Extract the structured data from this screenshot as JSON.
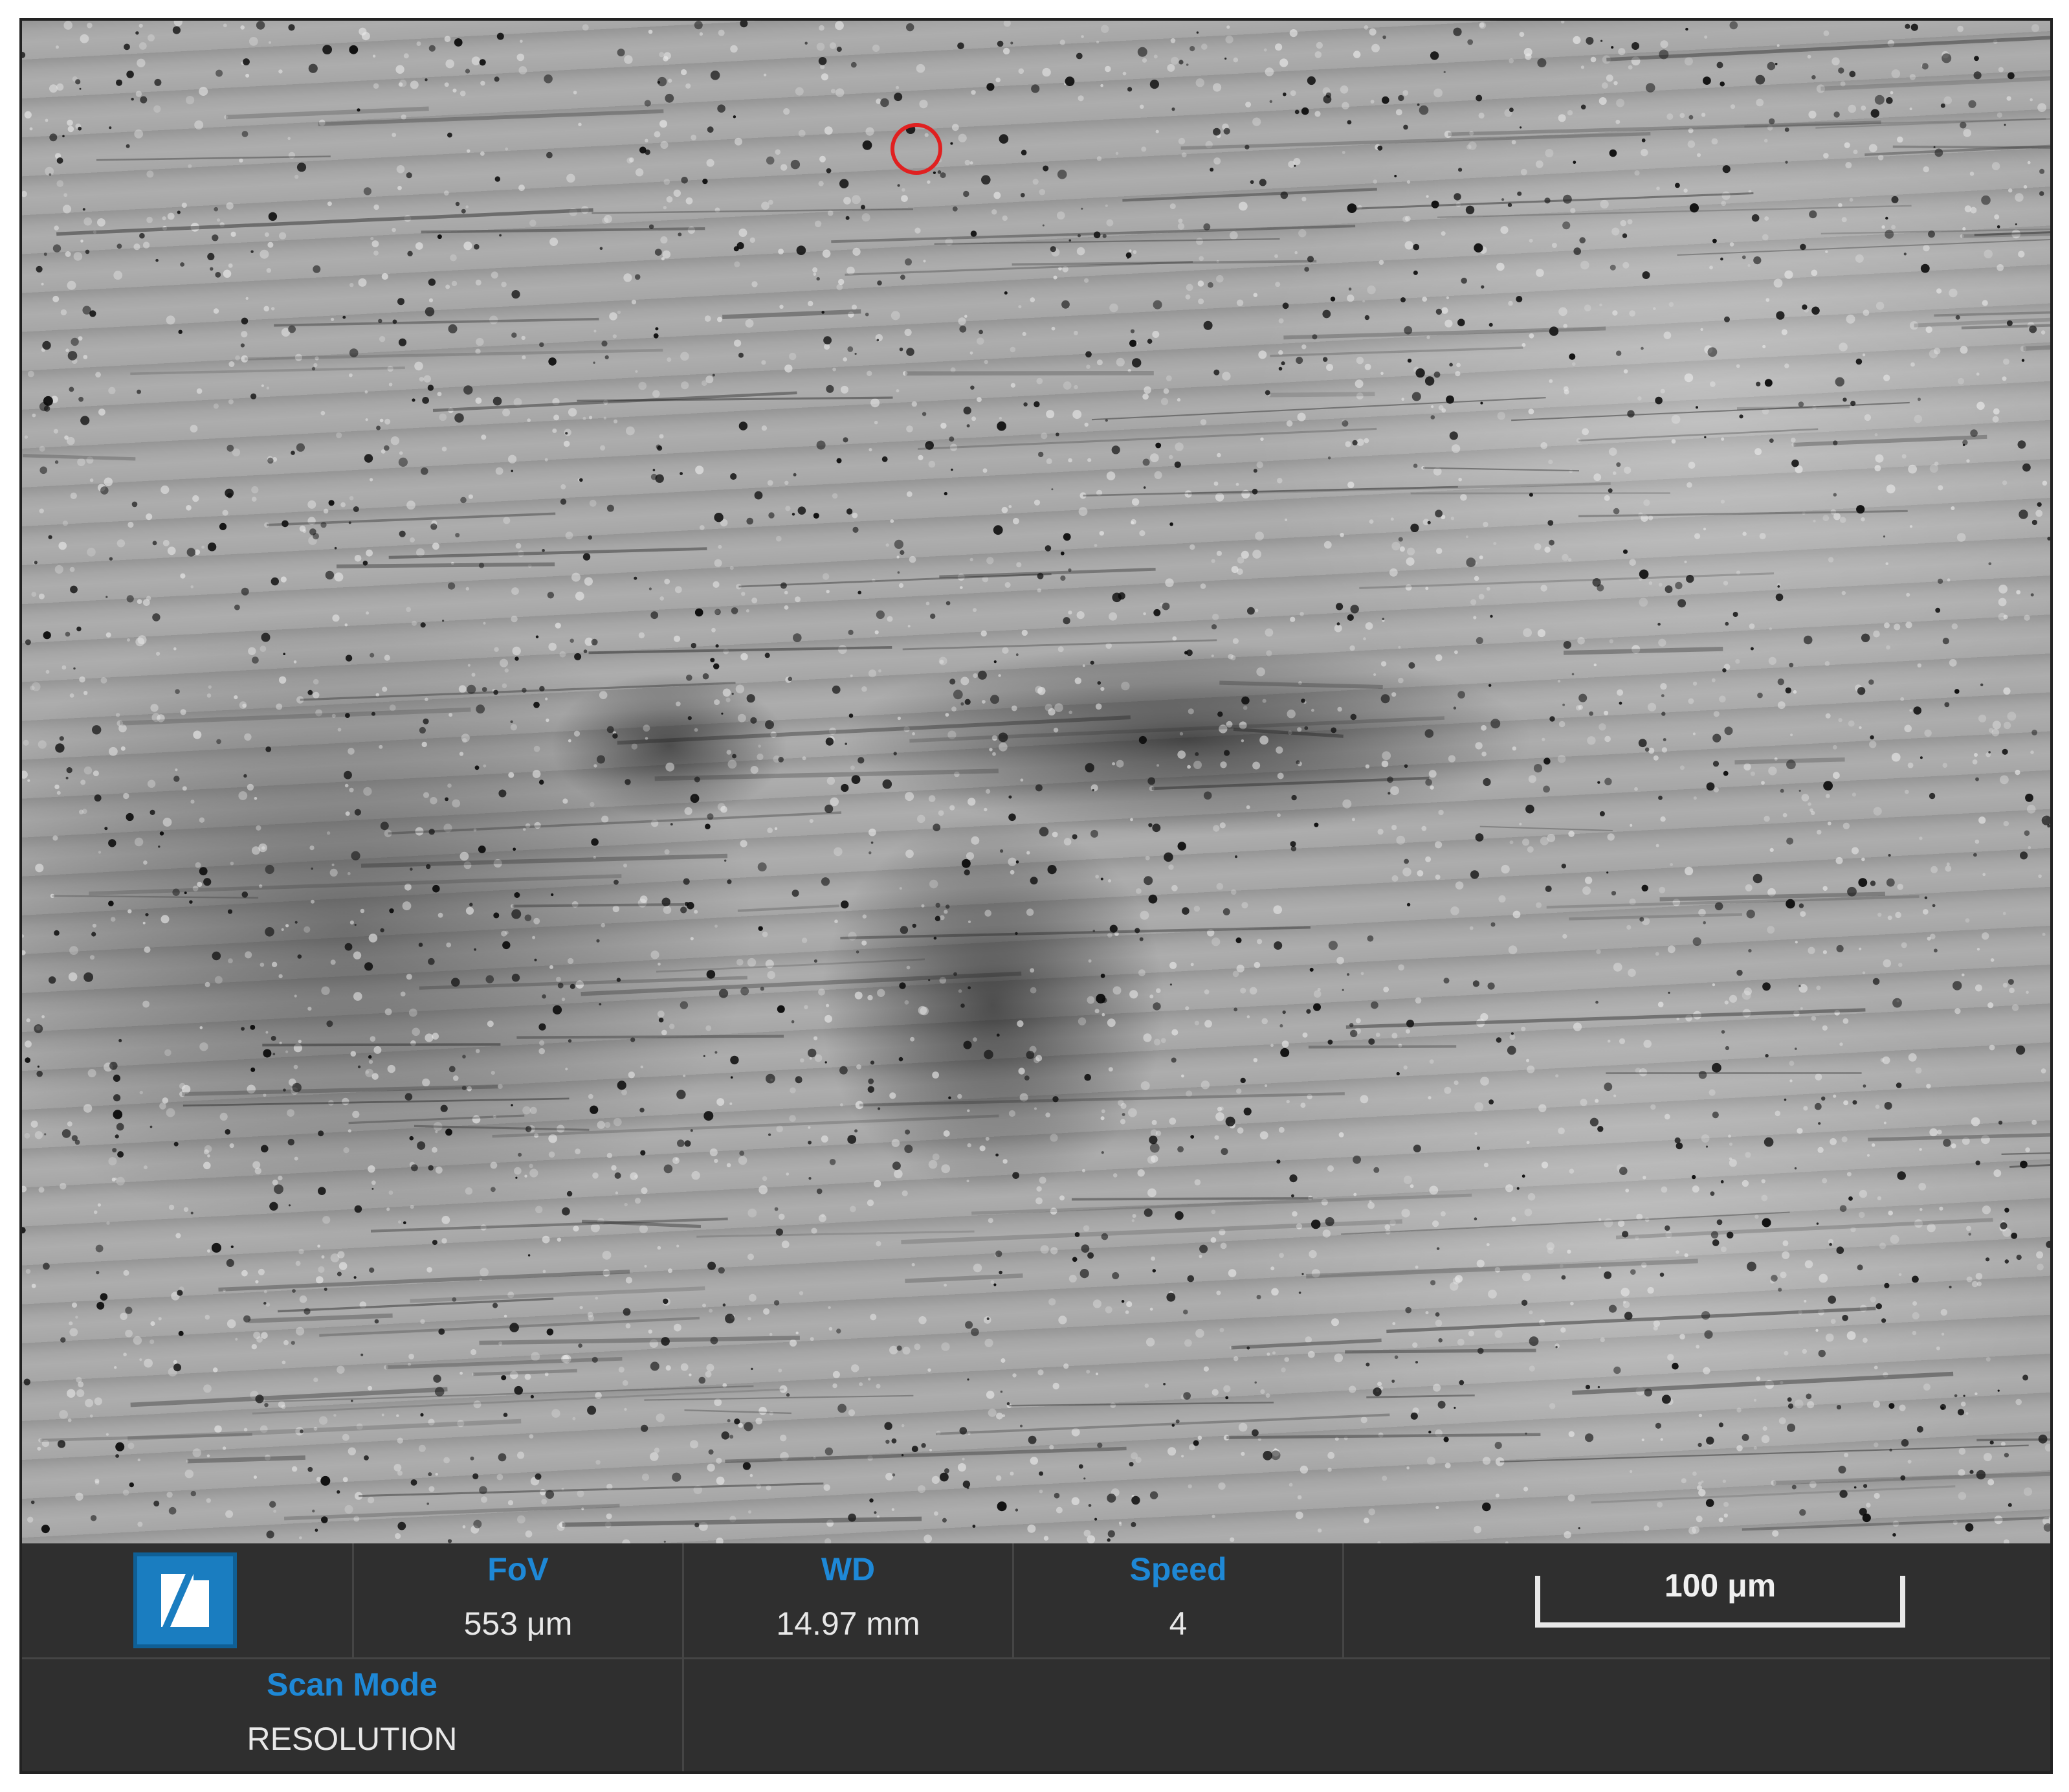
{
  "info": {
    "fov": {
      "label": "FoV",
      "value": "553 μm"
    },
    "wd": {
      "label": "WD",
      "value": "14.97 mm"
    },
    "speed": {
      "label": "Speed",
      "value": "4"
    },
    "scan_mode": {
      "label": "Scan Mode",
      "value": "RESOLUTION"
    },
    "scalebar": {
      "label": "100 μm"
    }
  },
  "colors": {
    "label_blue": "#1e88d6",
    "logo_blue": "#1a7dc0",
    "marker_red": "#e02020",
    "bar_bg": "#2f2f2f"
  },
  "icons": [
    "logo-icon"
  ]
}
